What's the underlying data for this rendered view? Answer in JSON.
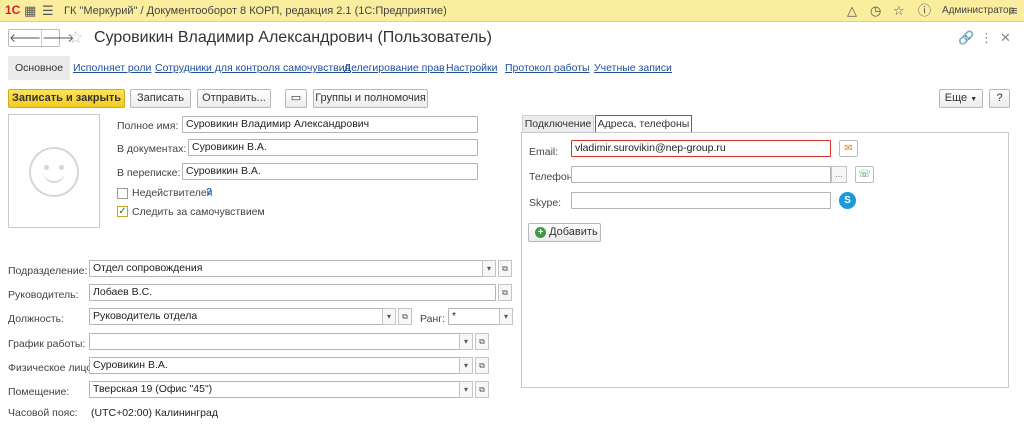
{
  "app": {
    "logo": "1С",
    "title": "ГК \"Меркурий\" / Документооборот 8 КОРП, редакция 2.1  (1С:Предприятие)",
    "user": "Администратор"
  },
  "form": {
    "title": "Суровикин Владимир Александрович (Пользователь)"
  },
  "sections": [
    "Основное",
    "Исполняет роли",
    "Сотрудники для контроля самочувствия",
    "Делегирование прав",
    "Настройки",
    "Протокол работы",
    "Учетные записи"
  ],
  "toolbar": {
    "save_close": "Записать и закрыть",
    "save": "Записать",
    "send": "Отправить...",
    "groups": "Группы и полномочия",
    "more": "Еще",
    "help": "?"
  },
  "main": {
    "full_name_label": "Полное имя:",
    "full_name": "Суровикин Владимир Александрович",
    "in_docs_label": "В документах:",
    "in_docs": "Суровикин В.А.",
    "in_letters_label": "В переписке:",
    "in_letters": "Суровикин В.А.",
    "invalid_label": "Недействителен",
    "invalid_help": "?",
    "watch_label": "Следить за самочувствием",
    "department_label": "Подразделение:",
    "department": "Отдел сопровождения",
    "manager_label": "Руководитель:",
    "manager": "Лобаев В.С.",
    "position_label": "Должность:",
    "position": "Руководитель отдела",
    "rank_label": "Ранг:",
    "rank": "*",
    "schedule_label": "График работы:",
    "schedule": "",
    "person_label": "Физическое лицо:",
    "person": "Суровикин В.А.",
    "room_label": "Помещение:",
    "room": "Тверская 19 (Офис \"45\")",
    "tz_label": "Часовой пояс:",
    "tz": "(UTC+02:00) Калининград"
  },
  "contact": {
    "tab_connection": "Подключение",
    "tab_addresses": "Адреса, телефоны",
    "email_label": "Email:",
    "email": "vladimir.surovikin@nep-group.ru",
    "phone_label": "Телефон:",
    "phone": "",
    "skype_label": "Skype:",
    "skype": "",
    "add_button": "Добавить"
  },
  "colors": {
    "title_bar": "#fbed9e",
    "primary_button": "#f4cb1f",
    "highlight": "#d9342b",
    "link": "#1f4f9a"
  }
}
